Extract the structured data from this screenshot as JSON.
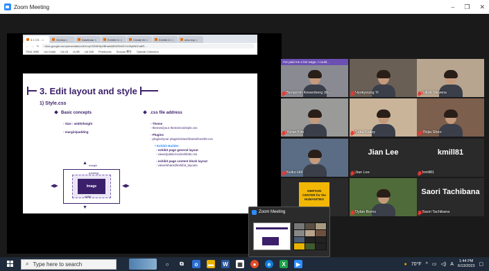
{
  "window": {
    "title": "Zoom Meeting",
    "minimize": "–",
    "maximize": "❐",
    "close": "✕"
  },
  "browser": {
    "tabs": [
      "3.1 CS... ×",
      "Omeka ×",
      "Dashboar ×",
      "Exhibit Cr ×",
      "Create Ite ×",
      "Exhibit Cr ×",
      "new-exp ×"
    ],
    "url": "docs.google.com/presentation/d/1mqYK5WHfp0Bhaiek8D63542tYxlJ9ytNDCa8R...",
    "bookmarks": [
      "TEAL WMI",
      "UA Guide",
      "UA 18",
      "IA 5B",
      "UA 308",
      "Pinebooks",
      "Scopus 學生",
      "Special Collection"
    ]
  },
  "slide": {
    "title": "3. Edit layout and style",
    "subtitle": "1) Style.css",
    "col1_heading": "Basic concepts",
    "col1_items": [
      "- Size : width/height",
      "- margin/padding"
    ],
    "col2_heading": ".css file address",
    "col2_items": [
      {
        "text": "- Theme",
        "bold": true
      },
      {
        "text": ": themes/your theme/css/style.css",
        "bold": false
      },
      {
        "text": "- Plugins",
        "bold": true
      },
      {
        "text": ": plugins/your plugin/views/shared/css/00.css",
        "bold": false
      },
      {
        "text": "* Exhibit Builder",
        "bold": true
      },
      {
        "text": "- exhibit page general layout",
        "bold": true
      },
      {
        "text": ": views/public/css/exhibits.css",
        "bold": false
      },
      {
        "text": "- exhibit page content block layout",
        "bold": true
      },
      {
        "text": ": views/shared/exhibit_layouts",
        "bold": false
      }
    ],
    "diagram": {
      "margin": "margin",
      "padding": "padding",
      "image": "Image",
      "width": "width"
    }
  },
  "participants": [
    {
      "name": "Benjamin Kiesenberg (th...",
      "banner": "I've paid me a fair wage, I could...",
      "bg": "#8a8a92"
    },
    {
      "name": "Hyokyoung Yi",
      "bg": "#6a5f55"
    },
    {
      "name": "Elliott Stevens",
      "bg": "#b8a58f"
    },
    {
      "name": "Yuran Kim",
      "bg": "#9a9a98",
      "highlight": true
    },
    {
      "name": "Erika Bailey",
      "bg": "#c9b49a"
    },
    {
      "name": "Zhijia Shen",
      "bg": "#7d5f4d"
    },
    {
      "name": "Keiko Hill",
      "bg": "#5a6d84"
    },
    {
      "name": "Jian Lee",
      "display": "Jian Lee"
    },
    {
      "name": "kmill81",
      "display": "kmill81"
    },
    {
      "name": "(she/her/hers)",
      "logo": [
        "SIMPSON",
        "CENTER for the",
        "HUMANITIES"
      ]
    },
    {
      "name": "Dylan Burns",
      "bg": "#4f6b3a"
    },
    {
      "name": "Saori Tachibana",
      "display": "Saori Tachibana"
    }
  ],
  "mini_window": {
    "title": "Zoom Meeting"
  },
  "taskbar": {
    "search_placeholder": "Type here to search",
    "weather": "70°F",
    "ime": "A",
    "time": "1:44 PM",
    "date": "6/13/2023"
  },
  "colors": {
    "accent": "#2d8cff",
    "slide_purple": "#3b1f6b",
    "highlight": "#e8e85a",
    "mic_off": "#e53935"
  }
}
